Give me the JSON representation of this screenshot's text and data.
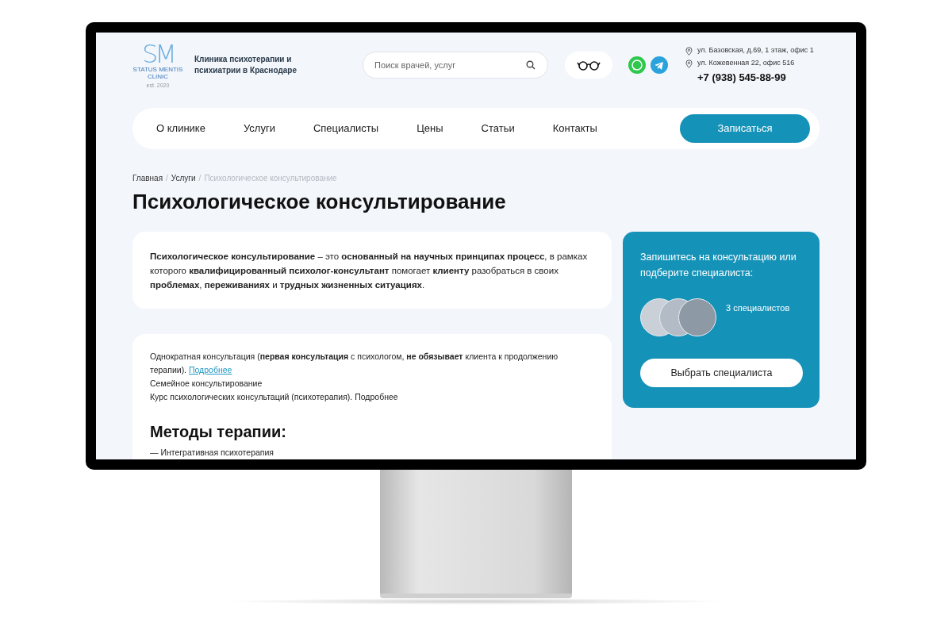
{
  "logo": {
    "monogram": "SM",
    "name": "STATUS MENTIS CLINIC",
    "est": "est. 2020"
  },
  "tagline": "Клиника психотерапии и психиатрии в Краснодаре",
  "search": {
    "placeholder": "Поиск врачей, услуг"
  },
  "addresses": [
    "ул. Базовская, д.69, 1 этаж, офис 1",
    "ул. Кожевенная 22, офис 516"
  ],
  "phone": "+7 (938) 545-88-99",
  "nav": [
    "О клинике",
    "Услуги",
    "Специалисты",
    "Цены",
    "Статьи",
    "Контакты"
  ],
  "cta": "Записаться",
  "breadcrumbs": [
    {
      "label": "Главная",
      "current": false
    },
    {
      "label": "Услуги",
      "current": false
    },
    {
      "label": "Психологическое консультирование",
      "current": true
    }
  ],
  "breadcrumb_separator": "/",
  "title": "Психологическое консультирование",
  "intro": "**Психологическое консультирование** – это **основанный на научных принципах процесс**, в рамках которого **квалифицированный психолог-консультант** помогает **клиенту** разобраться в своих **проблемах**, **переживаниях** и **трудных жизненных ситуациях**.",
  "services": [
    {
      "text": "Однократная консультация (**первая консультация** с психологом, **не обязывает** клиента к продолжению терапии). ",
      "link": "Подробнее"
    },
    {
      "text": "Семейное консультирование"
    },
    {
      "text": "Курс психологических консультаций (психотерапия). Подробнее"
    }
  ],
  "methods": {
    "heading": "Методы терапии:",
    "items": [
      "— Интегративная психотерапия"
    ]
  },
  "sidebar": {
    "heading": "Запишитесь на консультацию или подберите специалиста:",
    "count": "3 специалистов",
    "button": "Выбрать специалиста"
  }
}
